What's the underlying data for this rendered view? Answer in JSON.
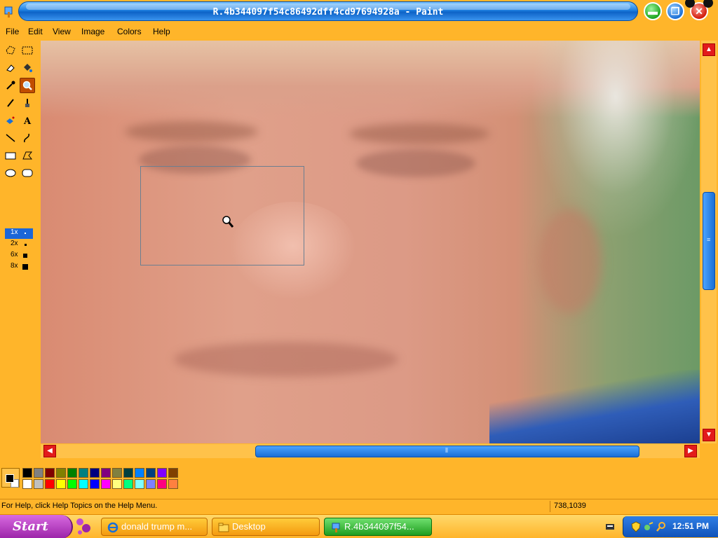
{
  "window": {
    "title": "R.4b344097f54c86492dff4cd97694928a - Paint"
  },
  "menu": [
    "File",
    "Edit",
    "View",
    "Image",
    "Colors",
    "Help"
  ],
  "toolbox": {
    "selected_tool": "magnifier-tool",
    "zoom_options": [
      "1x",
      "2x",
      "6x",
      "8x"
    ],
    "selected_zoom": "1x"
  },
  "palette": {
    "foreground": "#000000",
    "background": "#ffffff",
    "row1": [
      "#000000",
      "#808080",
      "#800000",
      "#808000",
      "#008000",
      "#008080",
      "#000080",
      "#800080",
      "#808040",
      "#004040",
      "#0080ff",
      "#004080",
      "#8000ff",
      "#804000"
    ],
    "row2": [
      "#ffffff",
      "#c0c0c0",
      "#ff0000",
      "#ffff00",
      "#00ff00",
      "#00ffff",
      "#0000ff",
      "#ff00ff",
      "#ffff80",
      "#00ff80",
      "#80ffff",
      "#8080ff",
      "#ff0080",
      "#ff8040"
    ]
  },
  "status": {
    "help_text": "For Help, click Help Topics on the Help Menu.",
    "coords": "738,1039"
  },
  "taskbar": {
    "start_label": "Start",
    "tasks": [
      {
        "label": "donald trump m...",
        "icon": "ie-icon",
        "active": false
      },
      {
        "label": "Desktop",
        "icon": "folder-icon",
        "active": false
      },
      {
        "label": "R.4b344097f54...",
        "icon": "paint-icon",
        "active": true
      }
    ],
    "clock": "12:51 PM"
  },
  "colors": {
    "accent": "#ffb52a",
    "title_blue": "#1e7fe0",
    "start_purple": "#9b23a8",
    "active_task_green": "#1f9d1f"
  }
}
